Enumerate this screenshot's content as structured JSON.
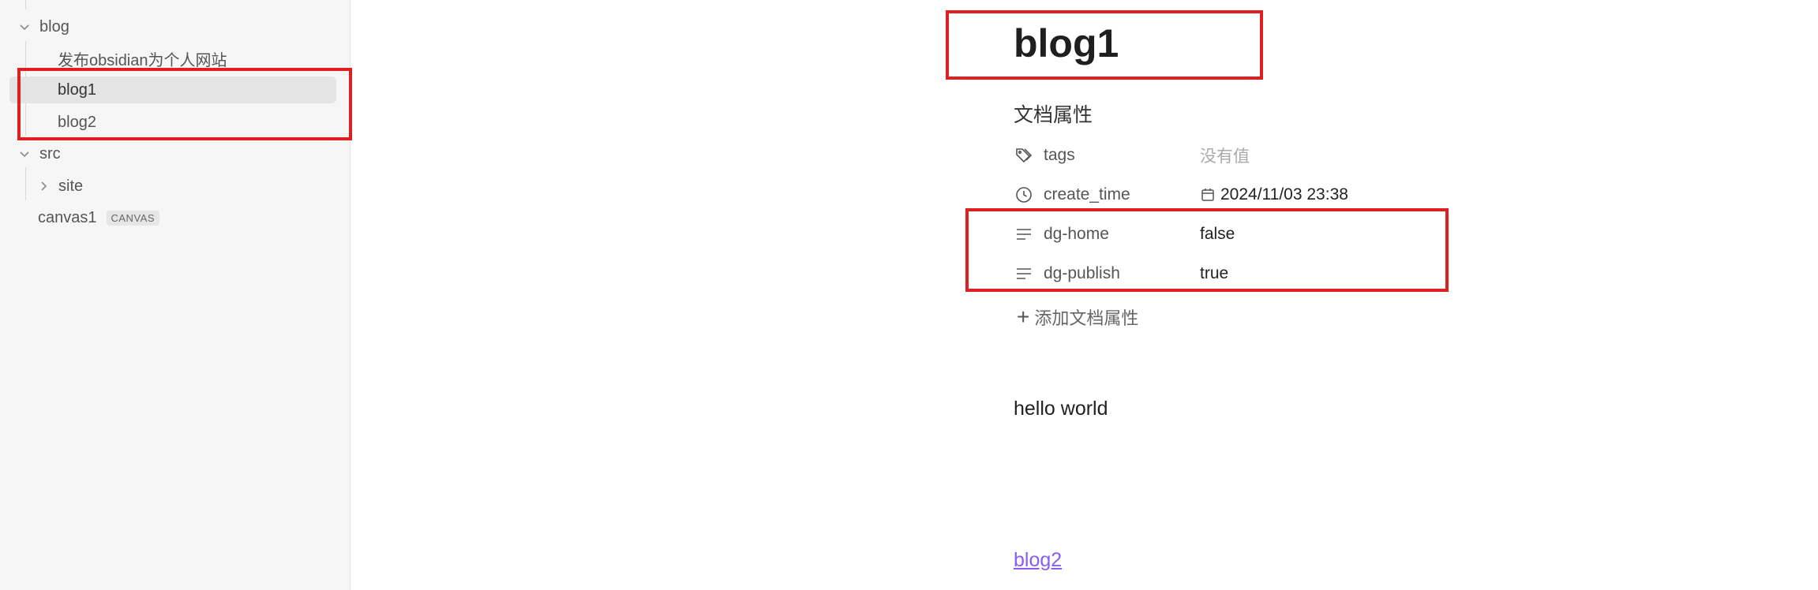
{
  "sidebar": {
    "items": [
      {
        "label": "blog",
        "level": 1,
        "expanded": true
      },
      {
        "label": "发布obsidian为个人网站",
        "level": 2
      },
      {
        "label": "blog1",
        "level": 2,
        "active": true
      },
      {
        "label": "blog2",
        "level": 2
      },
      {
        "label": "src",
        "level": 1,
        "expanded": true
      },
      {
        "label": "site",
        "level": 2,
        "collapsed": true
      },
      {
        "label": "canvas1",
        "level": 1,
        "badge": "CANVAS"
      }
    ]
  },
  "note": {
    "title": "blog1",
    "properties_heading": "文档属性",
    "properties": [
      {
        "key": "tags",
        "value": "没有值",
        "icon": "tag-icon",
        "empty": true
      },
      {
        "key": "create_time",
        "value": "2024/11/03 23:38",
        "icon": "clock-icon"
      },
      {
        "key": "dg-home",
        "value": "false",
        "icon": "text-lines-icon"
      },
      {
        "key": "dg-publish",
        "value": "true",
        "icon": "text-lines-icon"
      }
    ],
    "add_property": "添加文档属性",
    "body": "hello world",
    "link": "blog2"
  },
  "colors": {
    "highlight_box": "#e02020",
    "link": "#8a5cf5",
    "sidebar_bg": "#f6f6f6",
    "active_item_bg": "#e4e4e4"
  }
}
